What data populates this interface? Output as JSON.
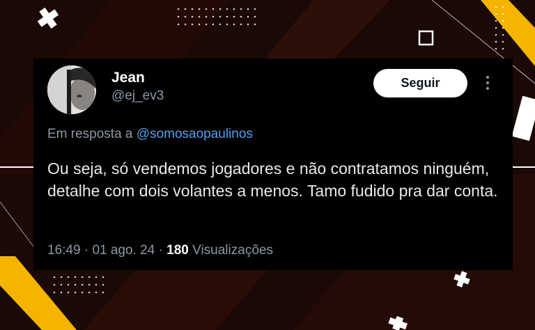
{
  "tweet": {
    "author_name": "Jean",
    "author_handle": "@ej_ev3",
    "follow_label": "Seguir",
    "reply_prefix": "Em resposta a",
    "reply_to": "@somosaopaulinos",
    "text": "Ou seja, só vendemos jogadores e não contratamos ninguém, detalhe com dois volantes a menos. Tamo fudido pra dar conta.",
    "time": "16:49",
    "sep1": "·",
    "date": "01 ago. 24",
    "sep2": "·",
    "view_count": "180",
    "view_label": "Visualizações"
  },
  "icons": {
    "more": "more-vertical-icon",
    "avatar": "avatar-photo"
  },
  "colors": {
    "card_bg": "#000000",
    "accent_yellow": "#f5b400",
    "mention_blue": "#5b9fe8",
    "muted": "#8b98a5"
  }
}
